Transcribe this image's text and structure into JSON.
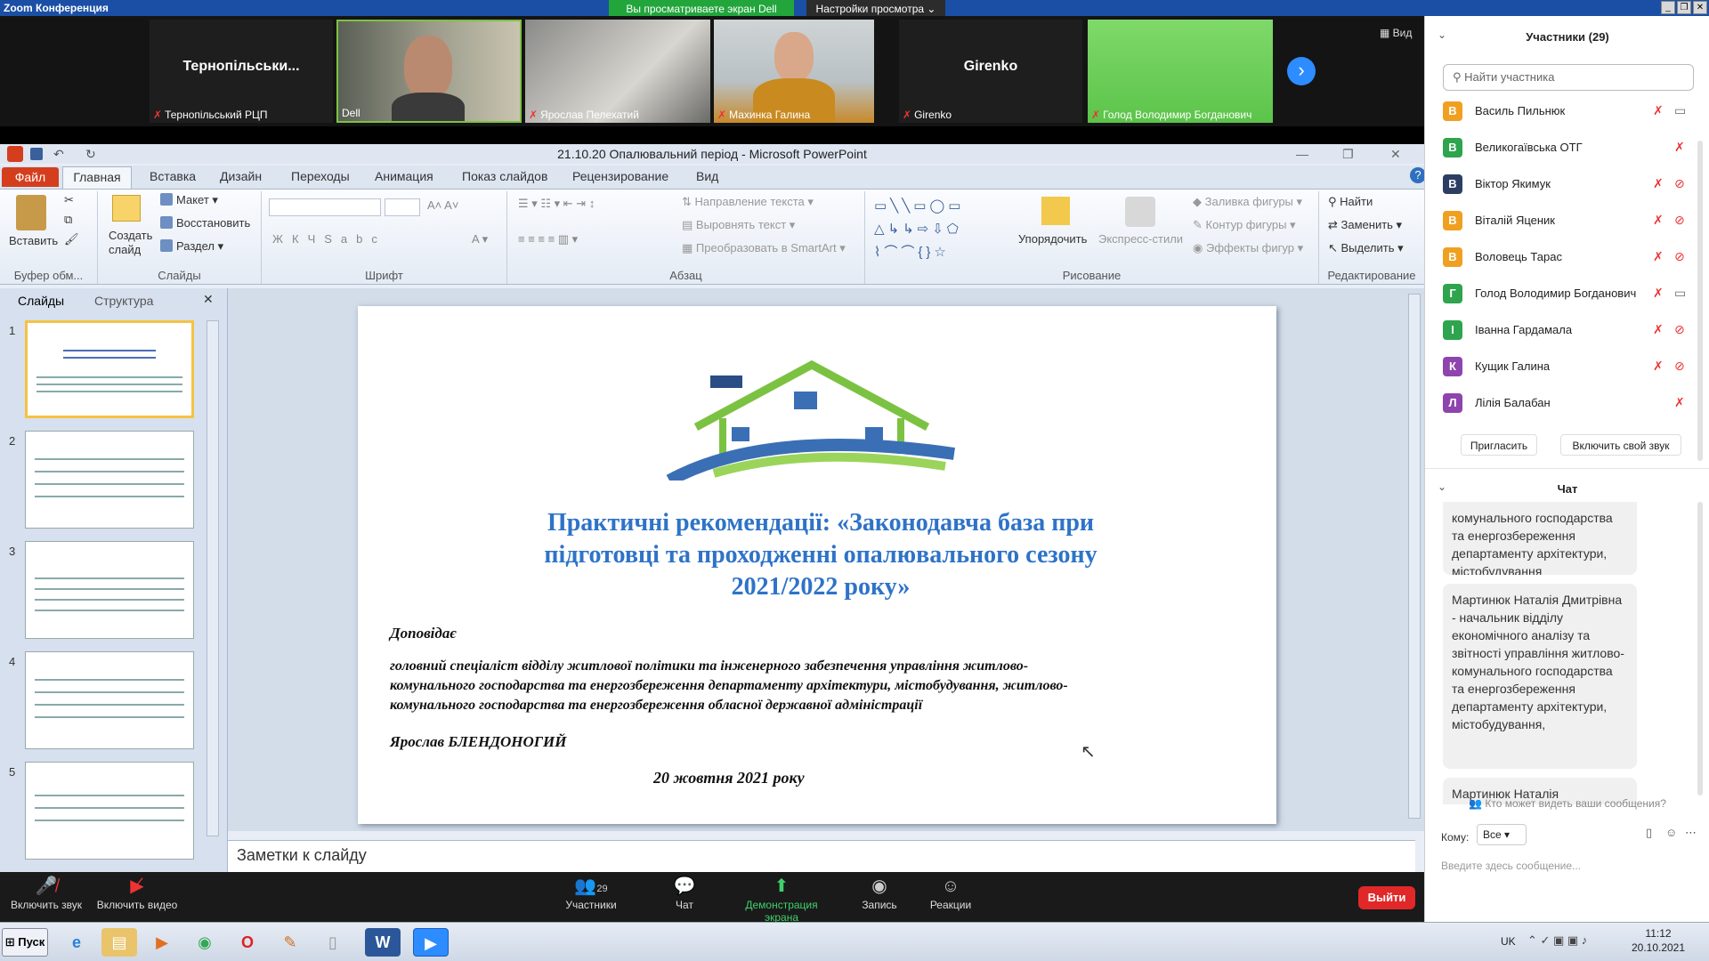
{
  "window": {
    "title": "Zoom Конференция",
    "share_banner": "Вы просматриваете экран Dell",
    "view_settings": "Настройки просмотра ⌄"
  },
  "video": {
    "tiles": [
      {
        "big_label": "Тернопільськи...",
        "name": "Тернопільський РЦП"
      },
      {
        "name": "Dell"
      },
      {
        "name": "Ярослав Пелехатий"
      },
      {
        "name": "Махинка Галина"
      },
      {
        "big_label": "Girenko",
        "name": "Girenko"
      },
      {
        "name": "Голод Володимир Богданович"
      }
    ],
    "view_label": "Вид"
  },
  "ppt": {
    "title": "21.10.20 Опалювальний період  -  Microsoft PowerPoint",
    "tabs": [
      "Файл",
      "Главная",
      "Вставка",
      "Дизайн",
      "Переходы",
      "Анимация",
      "Показ слайдов",
      "Рецензирование",
      "Вид"
    ],
    "ribbon": {
      "paste": "Вставить",
      "clipboard": "Буфер обм...",
      "create_slide": "Создать слайд",
      "layout": "Макет",
      "restore": "Восстановить",
      "section": "Раздел",
      "slides_group": "Слайды",
      "font_group": "Шрифт",
      "text_direction": "Направление текста",
      "align_text": "Выровнять текст",
      "smartart": "Преобразовать в SmartArt",
      "paragraph_group": "Абзац",
      "arrange": "Упорядочить",
      "quick_styles": "Экспресс-стили",
      "shape_fill": "Заливка фигуры",
      "shape_outline": "Контур фигуры",
      "shape_effects": "Эффекты фигур",
      "drawing_group": "Рисование",
      "find": "Найти",
      "replace": "Заменить",
      "select": "Выделить",
      "editing_group": "Редактирование"
    },
    "panel_tabs": [
      "Слайды",
      "Структура"
    ],
    "slide_numbers": [
      "1",
      "2",
      "3",
      "4",
      "5"
    ],
    "slide": {
      "title": "Практичні рекомендації: «Законодавча база при підготовці та проходженні опалювального сезону 2021/2022 року»",
      "reporter_label": "Доповідає",
      "position_line1": "головний спеціаліст відділу житлової політики та інженерного забезпечення управління житлово-",
      "position_line2": "комунального господарства та енергозбереження департаменту архітектури, містобудування, житлово-",
      "position_line3": "комунального господарства та енергозбереження обласної державної адміністрації",
      "speaker": "Ярослав БЛЕНДОНОГИЙ",
      "date": "20 жовтня 2021 року"
    },
    "notes_placeholder": "Заметки к слайду"
  },
  "toolbar": {
    "unmute": "Включить звук",
    "start_video": "Включить видео",
    "participants": "Участники",
    "participants_count": "29",
    "chat": "Чат",
    "share": "Демонстрация экрана",
    "record": "Запись",
    "reactions": "Реакции",
    "leave": "Выйти"
  },
  "participants": {
    "header": "Участники (29)",
    "search_placeholder": "Найти участника",
    "list": [
      {
        "initial": "В",
        "name": "Василь Пильнюк",
        "color": "#f0a020"
      },
      {
        "initial": "В",
        "name": "Великогаївська ОТГ",
        "color": "#2ea44f"
      },
      {
        "initial": "В",
        "name": "Віктор Якимук",
        "color": "#2c3e64"
      },
      {
        "initial": "В",
        "name": "Віталій Яценик",
        "color": "#f0a020"
      },
      {
        "initial": "В",
        "name": "Воловець Тарас",
        "color": "#f0a020"
      },
      {
        "initial": "Г",
        "name": "Голод Володимир Богданович",
        "color": "#2ea44f"
      },
      {
        "initial": "І",
        "name": "Іванна Гардамала",
        "color": "#2ea44f"
      },
      {
        "initial": "К",
        "name": "Кущик Галина",
        "color": "#8e44ad"
      },
      {
        "initial": "Л",
        "name": "Лілія Балабан",
        "color": "#8e44ad"
      }
    ],
    "invite": "Пригласить",
    "unmute_me": "Включить свой звук"
  },
  "chat": {
    "header": "Чат",
    "msg1": "комунального господарства та енергозбереження департаменту архітектури, містобудування",
    "msg2": "Мартинюк Наталія Дмитрівна - начальник відділу економічного аналізу та звітності управління житлово-комунального господарства та енергозбереження департаменту архітектури, містобудування,",
    "msg3": "Мартинюк Наталія",
    "who_can_see": "Кто может видеть ваши сообщения?",
    "to_label": "Кому:",
    "to_value": "Все",
    "input_placeholder": "Введите здесь сообщение..."
  },
  "taskbar": {
    "start": "Пуск",
    "lang": "UK",
    "time": "11:12",
    "date": "20.10.2021"
  }
}
